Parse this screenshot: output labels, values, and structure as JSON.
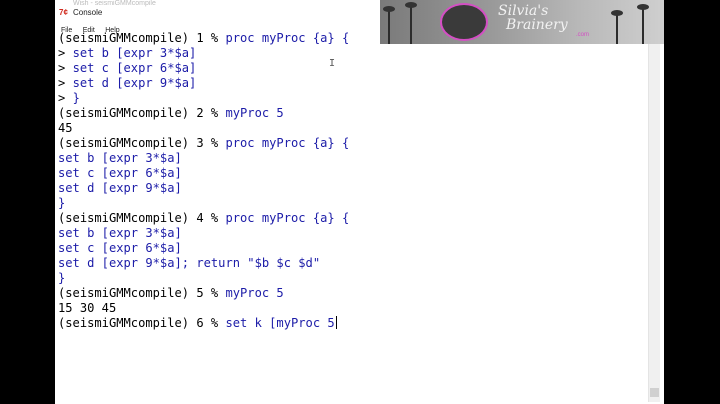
{
  "window": {
    "title_icon": "7¢",
    "title": "Console",
    "faint_title": "Wish - seismiGMMcompile"
  },
  "menu": [
    "File",
    "Edit",
    "Help"
  ],
  "banner": {
    "logo_line1": "Silvia's",
    "logo_line2": "Brainery",
    "logo_domain": ".com"
  },
  "console": {
    "lines": [
      {
        "prompt": "(seismiGMMcompile) 1 % ",
        "cmd": "proc myProc {a} {"
      },
      {
        "prompt": "> ",
        "cmd": "set b [expr 3*$a]"
      },
      {
        "prompt": "> ",
        "cmd": "set c [expr 6*$a]"
      },
      {
        "prompt": "> ",
        "cmd": "set d [expr 9*$a]"
      },
      {
        "prompt": "> ",
        "cmd": "}"
      },
      {
        "prompt": "(seismiGMMcompile) 2 % ",
        "cmd": "myProc 5"
      },
      {
        "prompt": "45",
        "cmd": ""
      },
      {
        "prompt": "(seismiGMMcompile) 3 % ",
        "cmd": "proc myProc {a} {"
      },
      {
        "prompt": "",
        "cmd": "set b [expr 3*$a]"
      },
      {
        "prompt": "",
        "cmd": "set c [expr 6*$a]"
      },
      {
        "prompt": "",
        "cmd": "set d [expr 9*$a]"
      },
      {
        "prompt": "",
        "cmd": "}"
      },
      {
        "prompt": "(seismiGMMcompile) 4 % ",
        "cmd": "proc myProc {a} {"
      },
      {
        "prompt": "",
        "cmd": "set b [expr 3*$a]"
      },
      {
        "prompt": "",
        "cmd": "set c [expr 6*$a]"
      },
      {
        "prompt": "",
        "cmd": "set d [expr 9*$a]; return \"$b $c $d\""
      },
      {
        "prompt": "",
        "cmd": "}"
      },
      {
        "prompt": "(seismiGMMcompile) 5 % ",
        "cmd": "myProc 5"
      },
      {
        "prompt": "15 30 45",
        "cmd": ""
      },
      {
        "prompt": "(seismiGMMcompile) 6 % ",
        "cmd": "set k [myProc 5"
      }
    ]
  },
  "colors": {
    "prompt": "#000000",
    "command": "#1c1ca8"
  }
}
